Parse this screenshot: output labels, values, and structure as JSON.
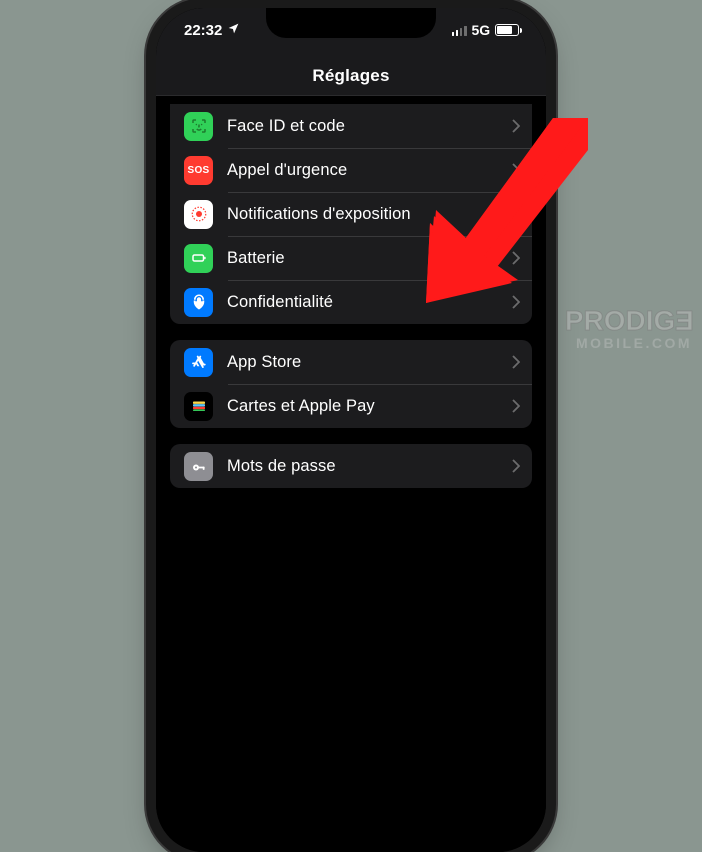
{
  "status": {
    "time": "22:32",
    "network_label": "5G"
  },
  "nav": {
    "title": "Réglages"
  },
  "groups": [
    {
      "id": "general",
      "rows": [
        {
          "id": "faceid",
          "label": "Face ID et code",
          "icon": "faceid-icon",
          "bg": "bg-green"
        },
        {
          "id": "sos",
          "label": "Appel d'urgence",
          "icon": "sos-icon",
          "bg": "bg-red"
        },
        {
          "id": "exposure",
          "label": "Notifications d'exposition",
          "icon": "exposure-icon",
          "bg": "bg-white"
        },
        {
          "id": "battery",
          "label": "Batterie",
          "icon": "battery-icon",
          "bg": "bg-green"
        },
        {
          "id": "privacy",
          "label": "Confidentialité",
          "icon": "privacy-icon",
          "bg": "bg-blue"
        }
      ]
    },
    {
      "id": "store",
      "rows": [
        {
          "id": "appstore",
          "label": "App Store",
          "icon": "appstore-icon",
          "bg": "bg-blue"
        },
        {
          "id": "wallet",
          "label": "Cartes et Apple Pay",
          "icon": "wallet-icon",
          "bg": ""
        }
      ]
    },
    {
      "id": "passwords",
      "rows": [
        {
          "id": "passwords",
          "label": "Mots de passe",
          "icon": "key-icon",
          "bg": "bg-grey"
        }
      ]
    }
  ],
  "watermark": {
    "line1": "PRODIGE",
    "line2": "MOBILE.COM"
  }
}
